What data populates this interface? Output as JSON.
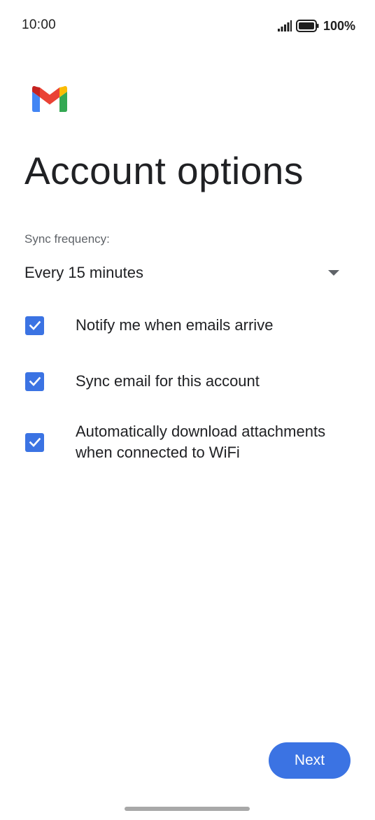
{
  "status_bar": {
    "time": "10:00",
    "battery": "100%",
    "icons": [
      "signal-icon",
      "battery-icon"
    ]
  },
  "app": {
    "logo": "gmail-logo",
    "colors": {
      "accent": "#3b73e3",
      "gmail_red": "#ea4335",
      "gmail_blue": "#4285f4",
      "gmail_green": "#34a853",
      "gmail_yellow": "#fbbc04"
    }
  },
  "page": {
    "title": "Account options"
  },
  "sync": {
    "label": "Sync frequency:",
    "selected": "Every 15 minutes"
  },
  "options": [
    {
      "label": "Notify me when emails arrive",
      "checked": true
    },
    {
      "label": "Sync email for this account",
      "checked": true
    },
    {
      "label": "Automatically download attachments when connected to WiFi",
      "checked": true
    }
  ],
  "actions": {
    "next_label": "Next"
  }
}
